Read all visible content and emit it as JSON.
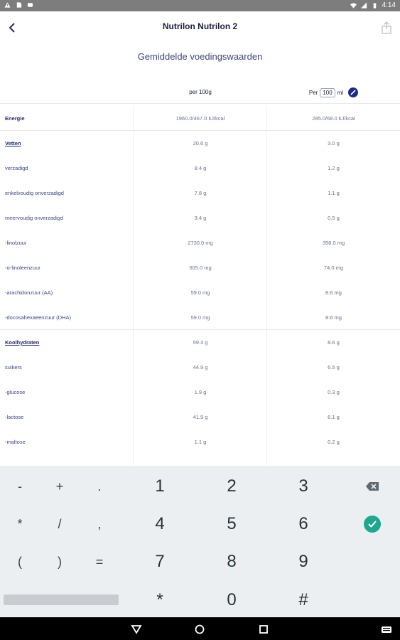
{
  "status_bar": {
    "time": "4:14",
    "icons": [
      "alert-icon",
      "sd-card-icon",
      "notification-icon",
      "wifi-icon",
      "signal-icon",
      "battery-icon"
    ]
  },
  "header": {
    "title": "Nutrilon Nutrilon 2",
    "back_icon": "chevron-left-icon",
    "share_icon": "share-icon"
  },
  "subtitle": "Gemiddelde voedingswaarden",
  "table": {
    "col1_header": "per 100g",
    "col2_prefix": "Per",
    "col2_amount": "100",
    "col2_unit": "ml",
    "rows": [
      {
        "label": "Energie",
        "per100g": "1960.0/467.0 kJ/kcal",
        "perml": "285.0/68.0 kJ/kcal"
      },
      {
        "label": "Vetten",
        "per100g": "20.6 g",
        "perml": "3.0 g"
      },
      {
        "label": "verzadigd",
        "per100g": "8.4 g",
        "perml": "1.2 g"
      },
      {
        "label": "enkelvoudig onverzadigd",
        "per100g": "7.8 g",
        "perml": "1.1 g"
      },
      {
        "label": "meervoudig onverzadigd",
        "per100g": "3.4 g",
        "perml": "0.5 g"
      },
      {
        "label": "-linolzuur",
        "per100g": "2730.0 mg",
        "perml": "398.0 mg"
      },
      {
        "label": "-α-linoleenzuur",
        "per100g": "505.0 mg",
        "perml": "74.0 mg"
      },
      {
        "label": "-arachidonzuur (AA)",
        "per100g": "59.0 mg",
        "perml": "8.6 mg"
      },
      {
        "label": "-docosahexaeenzuur (DHA)",
        "per100g": "59.0 mg",
        "perml": "8.6 mg"
      },
      {
        "label": "Koolhydraten",
        "per100g": "59.3 g",
        "perml": "8.6 g"
      },
      {
        "label": "suikers",
        "per100g": "44.9 g",
        "perml": "6.5 g"
      },
      {
        "label": "-glucose",
        "per100g": "1.9 g",
        "perml": "0.3 g"
      },
      {
        "label": "-lactose",
        "per100g": "41.9 g",
        "perml": "6.1 g"
      },
      {
        "label": "-maltose",
        "per100g": "1.1 g",
        "perml": "0.2 g"
      }
    ]
  },
  "keyboard": {
    "row1": [
      "-",
      "+",
      ".",
      "1",
      "2",
      "3"
    ],
    "row2": [
      "*",
      "/",
      ",",
      "4",
      "5",
      "6"
    ],
    "row3": [
      "(",
      ")",
      "=",
      "7",
      "8",
      "9"
    ],
    "row4": [
      "*",
      "0",
      "#"
    ],
    "backspace_icon": "backspace-icon",
    "done_icon": "checkmark-icon"
  },
  "nav_bar": {
    "icons": [
      "back-triangle-icon",
      "home-circle-icon",
      "recents-square-icon",
      "keyboard-icon"
    ]
  },
  "colors": {
    "accent": "#1e2a8a",
    "text": "#2a2f5a",
    "done": "#1ea88e",
    "keyboard_bg": "#eceff1"
  }
}
